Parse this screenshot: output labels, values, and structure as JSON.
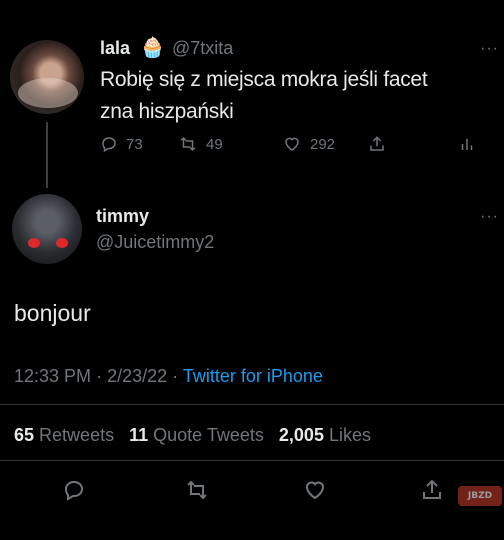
{
  "parent": {
    "name": "lala",
    "emoji": "🧁",
    "handle": "@7txita",
    "more": "···",
    "text_lines": [
      "Robię się z miejsca mokra jeśli facet",
      "zna hiszpański"
    ],
    "replies": "73",
    "retweets": "49",
    "likes": "292"
  },
  "reply": {
    "name": "timmy",
    "handle": "@Juicetimmy2",
    "more": "···",
    "text": "bonjour",
    "time": "12:33 PM",
    "date": "2/23/22",
    "source": "Twitter for iPhone",
    "retweets_count": "65",
    "retweets_label": "Retweets",
    "quotes_count": "11",
    "quotes_label": "Quote Tweets",
    "likes_count": "2,005",
    "likes_label": "Likes"
  },
  "watermark": "JBZD",
  "colors": {
    "background": "#000000",
    "text": "#e7e9ea",
    "muted": "#71767b",
    "link": "#1d9bf0",
    "divider": "#2f3336"
  },
  "icons": [
    "reply-icon",
    "retweet-icon",
    "like-icon",
    "share-icon",
    "analytics-icon",
    "more-icon"
  ]
}
